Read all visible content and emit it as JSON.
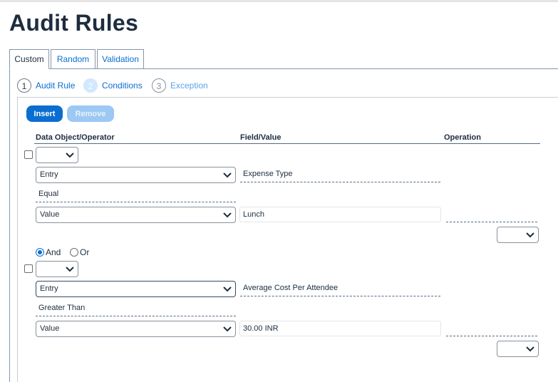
{
  "page": {
    "title": "Audit Rules"
  },
  "tabs": [
    {
      "label": "Custom",
      "active": true
    },
    {
      "label": "Random",
      "active": false
    },
    {
      "label": "Validation",
      "active": false
    }
  ],
  "steps": [
    {
      "number": "1",
      "label": "Audit Rule"
    },
    {
      "number": "2",
      "label": "Conditions"
    },
    {
      "number": "3",
      "label": "Exception"
    }
  ],
  "toolbar": {
    "insert_label": "Insert",
    "remove_label": "Remove"
  },
  "columns": {
    "data_object": "Data Object/Operator",
    "field_value": "Field/Value",
    "operation": "Operation"
  },
  "conditions": [
    {
      "data_object": "Entry",
      "field": "Expense Type",
      "operator": "Equal",
      "value_type": "Value",
      "value": "Lunch"
    },
    {
      "data_object": "Entry",
      "field": "Average Cost Per Attendee",
      "operator": "Greater Than",
      "value_type": "Value",
      "value": "30.00 INR"
    }
  ],
  "logic": {
    "and_label": "And",
    "or_label": "Or",
    "selected": "And"
  },
  "colors": {
    "accent": "#0a6ed1",
    "title": "#1d2d3e",
    "border": "#89919a"
  }
}
